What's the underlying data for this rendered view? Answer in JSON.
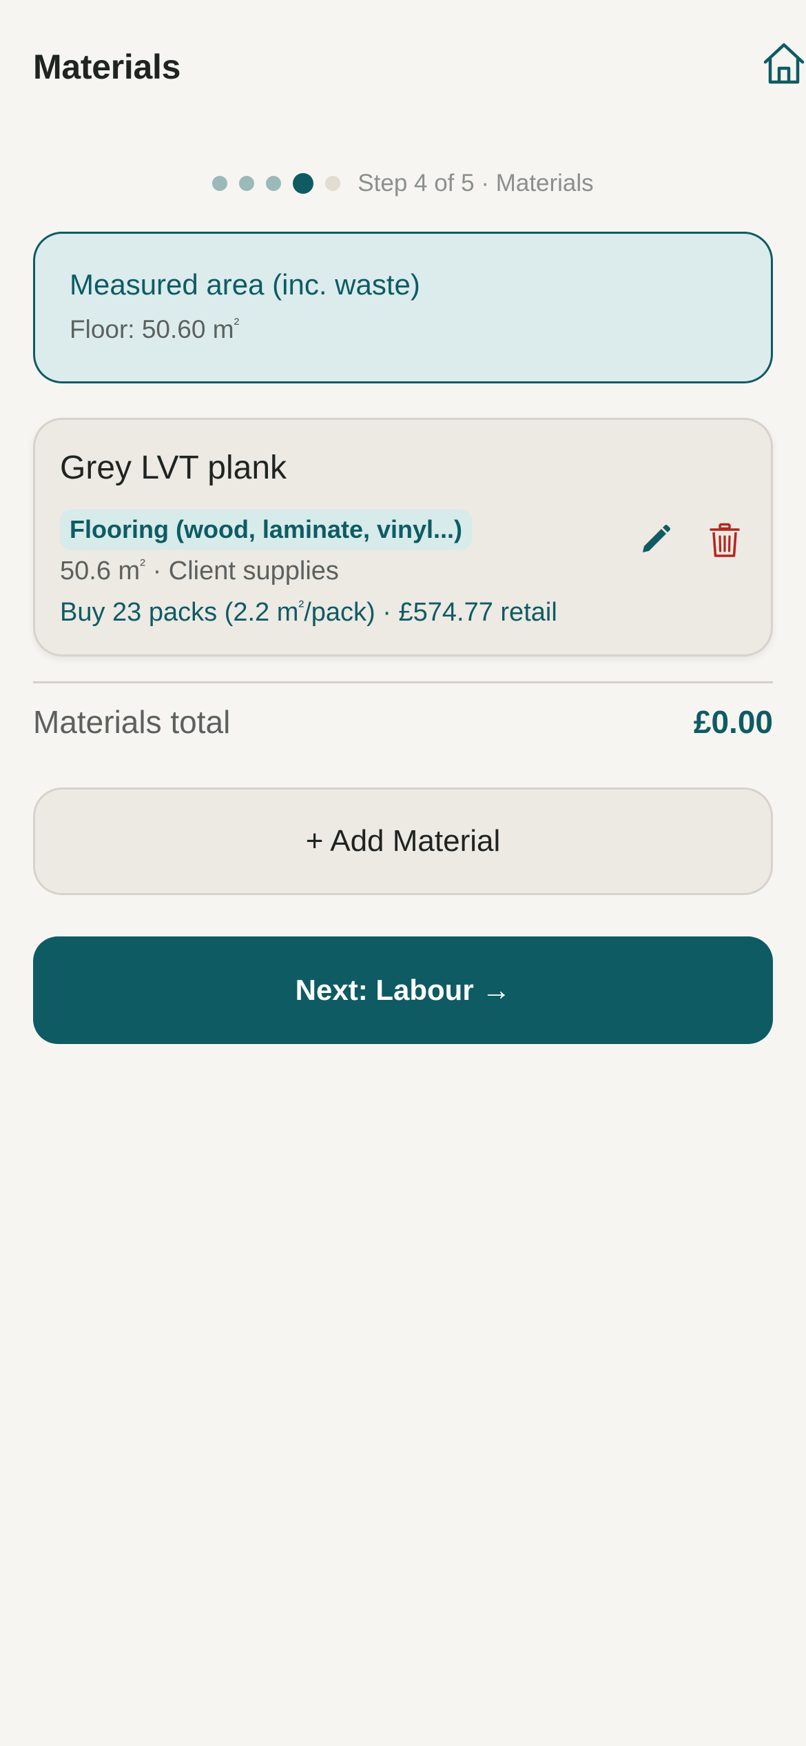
{
  "header": {
    "title": "Materials",
    "home_icon": "home-icon"
  },
  "stepper": {
    "total_steps": 5,
    "current_step": 4,
    "label": "Step 4 of 5 · Materials"
  },
  "area": {
    "title": "Measured area (inc. waste)",
    "value_prefix": "Floor: 50.60 m",
    "value_suffix": "²"
  },
  "material": {
    "name": "Grey LVT plank",
    "category": "Flooring (wood, laminate, vinyl...)",
    "qty_prefix": "50.6 m",
    "qty_unit_sup": "²",
    "qty_suffix": " · Client supplies",
    "buy_prefix": "Buy 23 packs (2.2 m",
    "buy_unit_sup": "²",
    "buy_suffix": "/pack) · £574.77 retail",
    "edit_icon": "pencil-icon",
    "delete_icon": "trash-icon"
  },
  "totals": {
    "label": "Materials total",
    "value": "£0.00"
  },
  "actions": {
    "add_label": "+ Add Material",
    "next_label": "Next: Labour →"
  },
  "colors": {
    "accent": "#0e5b64",
    "danger": "#b3261e",
    "background": "#f7f5f1",
    "card": "#ede9e3",
    "area_card": "#dcecec"
  }
}
